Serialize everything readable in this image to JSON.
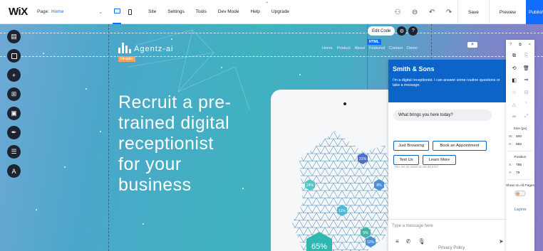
{
  "topbar": {
    "logo": "WiX",
    "page_label": "Page:",
    "page_value": "Home",
    "chevron": "⌄",
    "menu": [
      "Site",
      "Settings",
      "Tools",
      "Dev Mode",
      "Help",
      "Upgrade"
    ],
    "save": "Save",
    "preview": "Preview",
    "publish": "Publish"
  },
  "canvas": {
    "brand": "Agentz-ai",
    "header_tag": "Header",
    "edit_code": "Edit Code",
    "html_tag": "HTML",
    "nav": [
      "Home",
      "Product",
      "About",
      "Featured",
      "Contact",
      "Demo"
    ],
    "hero": [
      "Recruit a pre-",
      "trained digital",
      "receptionist",
      "for your",
      "business"
    ],
    "hex_labels": [
      "31%",
      "24%",
      "8%",
      "11%",
      "5%",
      "12%",
      "65%"
    ]
  },
  "chat": {
    "title": "Smith & Sons",
    "intro": "I'm a digital receptionist. I can answer some routine questions or take a message.",
    "question": "What brings you here today?",
    "options": [
      "Just Browsing",
      "Book an Appointment",
      "Text Us",
      "Learn More"
    ],
    "timestamp": "Thu Jul 30 2020 11:55:46 EST",
    "input_placeholder": "Type a message here",
    "privacy": "Privacy Policy"
  },
  "panel": {
    "top": [
      "?",
      "⧉",
      "×"
    ],
    "size_label": "Size (px)",
    "w_key": "W:",
    "w_val": "500",
    "h_key": "H:",
    "h_val": "682",
    "position_label": "Position",
    "x_key": "X:",
    "x_val": "785",
    "y_key": "Y:",
    "y_val": "79",
    "show_all": "Show on All Pages",
    "layers": "Layers"
  },
  "colors": {
    "accent": "#116dff",
    "chat_header": "#0d64c8",
    "header_tag": "#f5a25d"
  }
}
